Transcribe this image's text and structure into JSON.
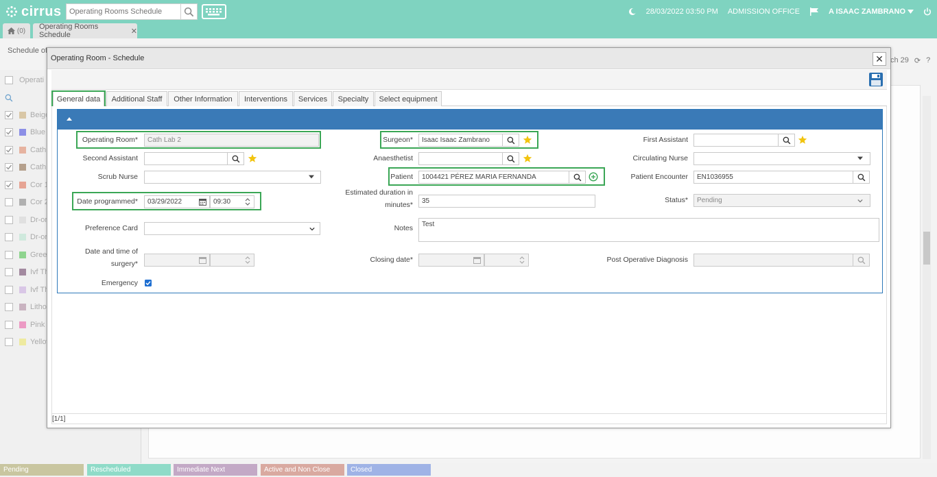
{
  "topbar": {
    "brand": "cirrus",
    "search_placeholder": "Operating Rooms Schedule",
    "datetime": "28/03/2022 03:50 PM",
    "office": "ADMISSION OFFICE",
    "user": "A ISAAC ZAMBRANO",
    "accent_color": "#7fd3c0"
  },
  "tabs": {
    "home_count": "(0)",
    "page_tab": "Operating Rooms Schedule"
  },
  "background": {
    "title": "Schedule of s",
    "column_header": "Operati",
    "right_date": "ch 29",
    "rows": [
      {
        "label": "Beige",
        "color": "#d9c7a6",
        "checked": true
      },
      {
        "label": "Blue",
        "color": "#8c8fe6",
        "checked": true
      },
      {
        "label": "Cath L",
        "color": "#e6b3a0",
        "checked": true
      },
      {
        "label": "Cath L",
        "color": "#b5a08c",
        "checked": true
      },
      {
        "label": "Cor 1",
        "color": "#e6a494",
        "checked": true
      },
      {
        "label": "Cor 2",
        "color": "#b0b0b0",
        "checked": false
      },
      {
        "label": "Dr-or",
        "color": "#e0e0e0",
        "checked": false
      },
      {
        "label": "Dr-or",
        "color": "#cfe9dd",
        "checked": false
      },
      {
        "label": "Green",
        "color": "#8fd48f",
        "checked": false
      },
      {
        "label": "Ivf Th",
        "color": "#a38aa0",
        "checked": false
      },
      {
        "label": "Ivf Th",
        "color": "#d9c7e6",
        "checked": false
      },
      {
        "label": "Lithot",
        "color": "#c9b3c0",
        "checked": false
      },
      {
        "label": "Pink",
        "color": "#ec9ac4",
        "checked": false
      },
      {
        "label": "Yellow",
        "color": "#eeeaa0",
        "checked": false
      }
    ]
  },
  "legend": [
    {
      "label": "Pending",
      "color": "#c9c6a0"
    },
    {
      "label": "Rescheduled",
      "color": "#8fdbc8"
    },
    {
      "label": "Immediate Next",
      "color": "#c3a9c6"
    },
    {
      "label": "Active and Non Close",
      "color": "#d9a9a0"
    },
    {
      "label": "Closed",
      "color": "#9fb3e6"
    }
  ],
  "modal": {
    "title": "Operating Room - Schedule",
    "tabs": [
      "General data",
      "Additional Staff",
      "Other Information",
      "Interventions",
      "Services",
      "Specialty",
      "Select equipment"
    ],
    "footer": "[1/1]",
    "form": {
      "operating_room": {
        "label": "Operating Room*",
        "value": "Cath Lab 2"
      },
      "surgeon": {
        "label": "Surgeon*",
        "value": "Isaac Isaac Zambrano"
      },
      "first_assistant": {
        "label": "First Assistant",
        "value": ""
      },
      "second_assistant": {
        "label": "Second Assistant",
        "value": ""
      },
      "anaesthetist": {
        "label": "Anaesthetist",
        "value": ""
      },
      "circulating_nurse": {
        "label": "Circulating Nurse",
        "value": ""
      },
      "scrub_nurse": {
        "label": "Scrub Nurse",
        "value": ""
      },
      "patient": {
        "label": "Patient",
        "value": "1004421 PÉREZ MARIA FERNANDA"
      },
      "patient_encounter": {
        "label": "Patient Encounter",
        "value": "EN1036955"
      },
      "date_programmed": {
        "label": "Date programmed*",
        "date": "03/29/2022",
        "time": "09:30"
      },
      "estimated_duration": {
        "label_line1": "Estimated duration in",
        "label_line2": "minutes*",
        "value": "35"
      },
      "status": {
        "label": "Status*",
        "value": "Pending"
      },
      "preference_card": {
        "label": "Preference Card",
        "value": ""
      },
      "notes": {
        "label": "Notes",
        "value": "Test"
      },
      "date_time_surgery": {
        "label_line1": "Date and time of",
        "label_line2": "surgery*"
      },
      "closing_date": {
        "label": "Closing date*"
      },
      "post_op_diagnosis": {
        "label": "Post Operative Diagnosis",
        "value": ""
      },
      "emergency": {
        "label": "Emergency",
        "checked": true
      }
    }
  }
}
